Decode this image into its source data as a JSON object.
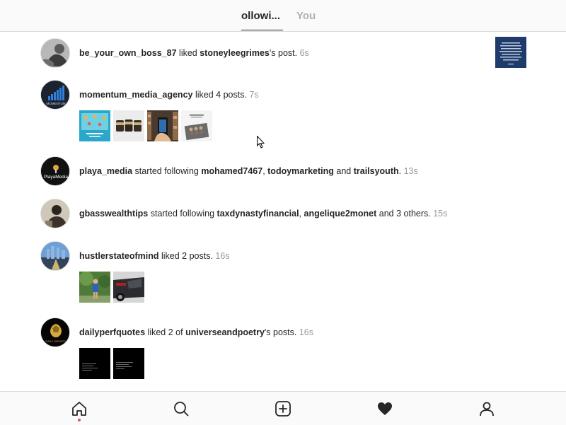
{
  "header": {
    "tab_following": "ollowi...",
    "tab_you": "You"
  },
  "feed": [
    {
      "segments": [
        {
          "text": "be_your_own_boss_87",
          "bold": true
        },
        {
          "text": " liked ",
          "bold": false
        },
        {
          "text": "stoneyleegrimes",
          "bold": true
        },
        {
          "text": "'s post. ",
          "bold": false
        }
      ],
      "time": "6s"
    },
    {
      "segments": [
        {
          "text": "momentum_media_agency",
          "bold": true
        },
        {
          "text": " liked 4 posts. ",
          "bold": false
        }
      ],
      "time": "7s",
      "avatar_text": "MOMENTUM"
    },
    {
      "segments": [
        {
          "text": "playa_media",
          "bold": true
        },
        {
          "text": " started following ",
          "bold": false
        },
        {
          "text": "mohamed7467",
          "bold": true
        },
        {
          "text": ", ",
          "bold": false
        },
        {
          "text": "todoymarketing",
          "bold": true
        },
        {
          "text": " and ",
          "bold": false
        },
        {
          "text": "trailsyouth",
          "bold": true
        },
        {
          "text": ". ",
          "bold": false
        }
      ],
      "time": "13s",
      "avatar_text": "PlayaMedia"
    },
    {
      "segments": [
        {
          "text": "gbasswealthtips",
          "bold": true
        },
        {
          "text": " started following ",
          "bold": false
        },
        {
          "text": "taxdynastyfinancial",
          "bold": true
        },
        {
          "text": ", ",
          "bold": false
        },
        {
          "text": "angelique2monet",
          "bold": true
        },
        {
          "text": " and 3 others. ",
          "bold": false
        }
      ],
      "time": "15s"
    },
    {
      "segments": [
        {
          "text": "hustlerstateofmind",
          "bold": true
        },
        {
          "text": " liked 2 posts. ",
          "bold": false
        }
      ],
      "time": "16s"
    },
    {
      "segments": [
        {
          "text": "dailyperfquotes",
          "bold": true
        },
        {
          "text": " liked 2 of ",
          "bold": false
        },
        {
          "text": "universeandpoetry",
          "bold": true
        },
        {
          "text": "'s posts. ",
          "bold": false
        }
      ],
      "time": "16s",
      "avatar_text": "DAILY GROWTH"
    }
  ],
  "nav": [
    "home-icon",
    "search-icon",
    "new-post-icon",
    "activity-heart-icon",
    "profile-icon"
  ],
  "colors": {
    "notification_dot": "#ed4956",
    "muted_text": "#999999",
    "text": "#262626"
  }
}
